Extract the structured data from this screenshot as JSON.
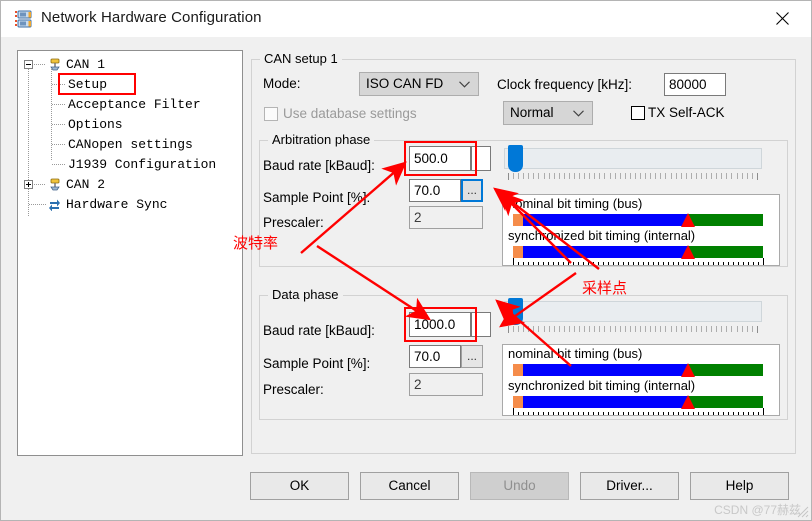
{
  "window": {
    "title": "Network Hardware Configuration",
    "icon": "network-hardware-icon",
    "close_label": "✕"
  },
  "tree": {
    "nodes": [
      {
        "label": "CAN 1",
        "icon": "can-channel-icon",
        "expander": "minus",
        "level": 0,
        "selected": false
      },
      {
        "label": "Setup",
        "icon": "none",
        "expander": "none",
        "level": 1,
        "selected": true
      },
      {
        "label": "Acceptance Filter",
        "icon": "none",
        "expander": "none",
        "level": 1,
        "selected": false
      },
      {
        "label": "Options",
        "icon": "none",
        "expander": "none",
        "level": 1,
        "selected": false
      },
      {
        "label": "CANopen settings",
        "icon": "none",
        "expander": "none",
        "level": 1,
        "selected": false
      },
      {
        "label": "J1939 Configuration",
        "icon": "none",
        "expander": "none",
        "level": 1,
        "selected": false
      },
      {
        "label": "CAN 2",
        "icon": "can-channel-icon",
        "expander": "plus",
        "level": 0,
        "selected": false
      },
      {
        "label": "Hardware Sync",
        "icon": "hardware-sync-icon",
        "expander": "none",
        "level": 0,
        "selected": false
      }
    ]
  },
  "setup": {
    "group_title": "CAN setup 1",
    "mode_label": "Mode:",
    "mode_value": "ISO CAN FD",
    "clock_label": "Clock frequency [kHz]:",
    "clock_value": "80000",
    "use_database_label": "Use database settings",
    "use_database_checked": false,
    "acknowledge_value": "Normal",
    "tx_self_ack_label": "TX Self-ACK",
    "tx_self_ack_checked": false
  },
  "arbitration": {
    "group_title": "Arbitration phase",
    "baud_label": "Baud rate [kBaud]:",
    "baud_value": "500.0",
    "sample_label": "Sample Point [%]:",
    "sample_value": "70.0",
    "sample_browse_label": "...",
    "prescaler_label": "Prescaler:",
    "prescaler_value": "2",
    "timing": {
      "nominal_caption": "nominal bit timing (bus)",
      "sync_caption": "synchronized bit timing (internal)",
      "sync_pct": 4.0,
      "prop_pct": 66.0,
      "phase2_pct": 30.0,
      "sample_point_pct": 70.0
    }
  },
  "dataphase": {
    "group_title": "Data phase",
    "baud_label": "Baud rate [kBaud]:",
    "baud_value": "1000.0",
    "sample_label": "Sample Point [%]:",
    "sample_value": "70.0",
    "sample_browse_label": "...",
    "prescaler_label": "Prescaler:",
    "prescaler_value": "2",
    "timing": {
      "nominal_caption": "nominal bit timing (bus)",
      "sync_caption": "synchronized bit timing (internal)",
      "sync_pct": 4.0,
      "prop_pct": 66.0,
      "phase2_pct": 30.0,
      "sample_point_pct": 70.0
    }
  },
  "buttons": {
    "ok": "OK",
    "cancel": "Cancel",
    "undo": "Undo",
    "driver": "Driver...",
    "help": "Help"
  },
  "annotations": {
    "baud_rate_cn": "波特率",
    "sample_point_cn": "采样点"
  },
  "watermark": "CSDN @77赫兹",
  "colors": {
    "accent": "#0078d7",
    "annotation": "#ff0000",
    "bit_sync": "#f58c4a",
    "bit_prop": "#0000ff",
    "bit_phase2": "#008000",
    "marker": "#ff0000"
  }
}
